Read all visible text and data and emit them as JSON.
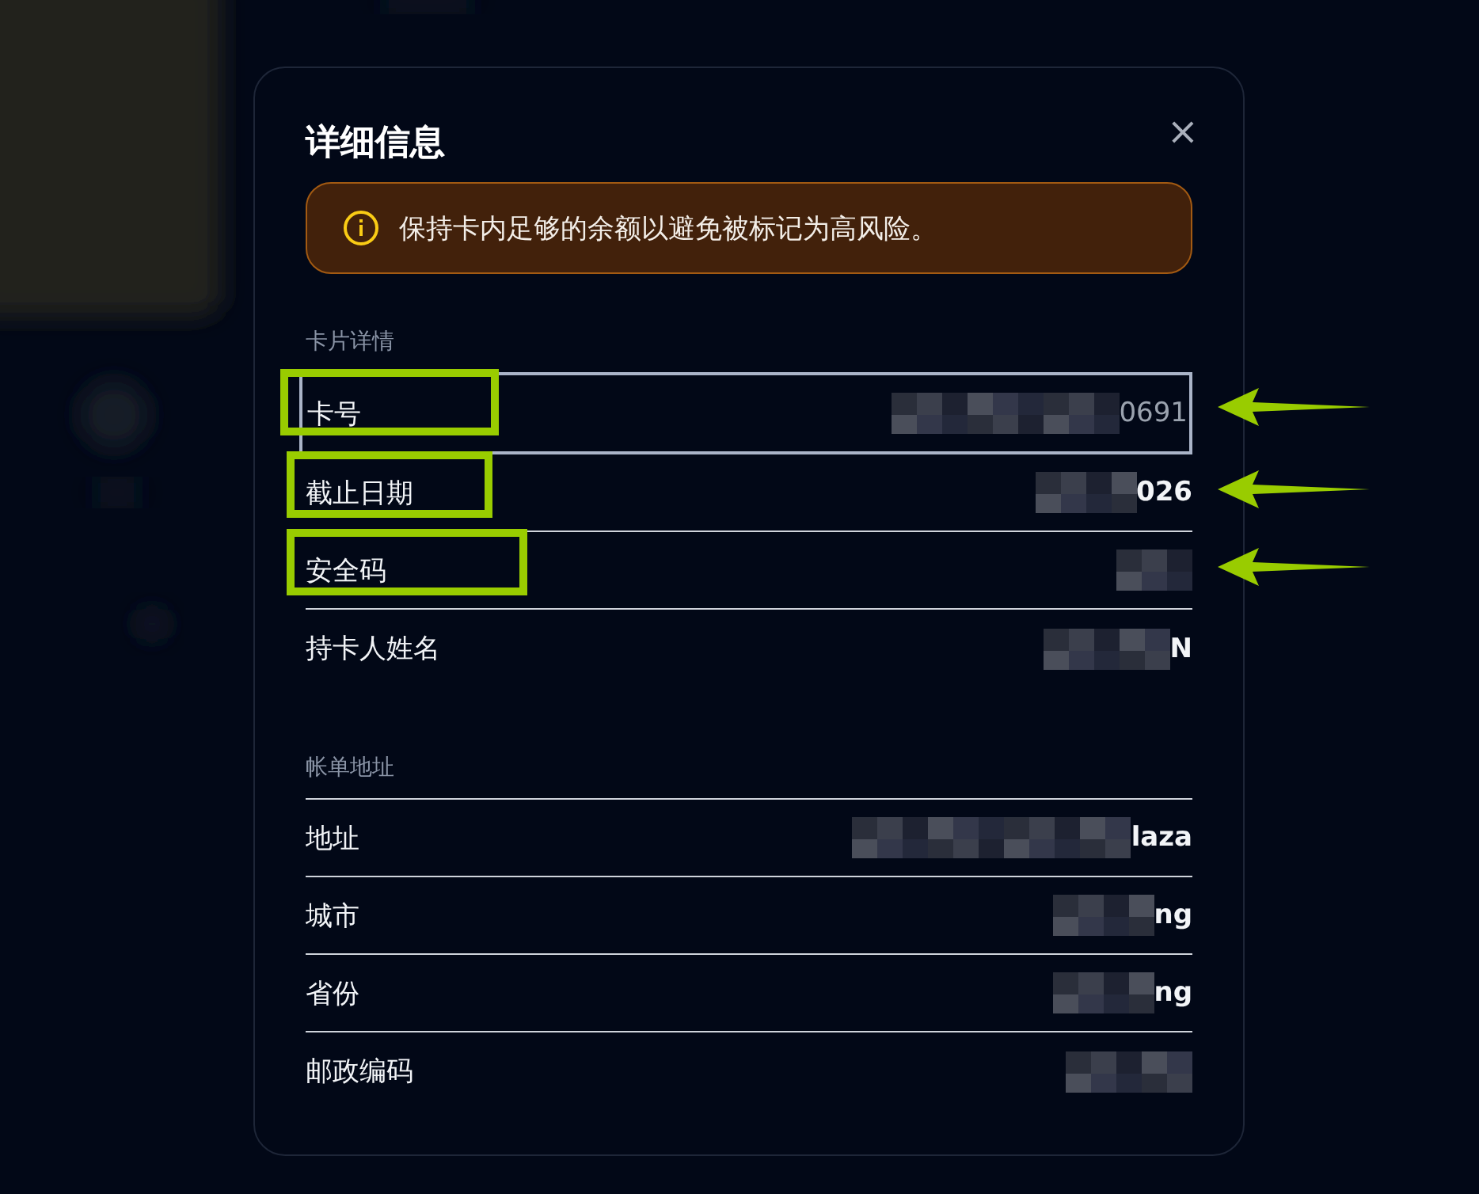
{
  "dialog": {
    "title": "详细信息",
    "close": "×",
    "alert": {
      "text": "保持卡内足够的余额以避免被标记为高风险。"
    },
    "sections": [
      {
        "heading": "卡片详情",
        "rows": [
          {
            "label": "卡号",
            "value": "0691",
            "focused": true,
            "redacted": true,
            "annotated": true
          },
          {
            "label": "截止日期",
            "value": "026",
            "focused": false,
            "redacted": true,
            "annotated": true
          },
          {
            "label": "安全码",
            "focused": false,
            "redacted": true,
            "annotated": true
          },
          {
            "label": "持卡人姓名",
            "value": "N",
            "focused": false,
            "redacted": true,
            "annotated": false
          }
        ]
      },
      {
        "heading": "帐单地址",
        "rows": [
          {
            "label": "地址",
            "value": "laza",
            "focused": false,
            "redacted": true,
            "annotated": false
          },
          {
            "label": "城市",
            "value": "ng",
            "focused": false,
            "redacted": true,
            "annotated": false
          },
          {
            "label": "省份",
            "value": "ng",
            "focused": false,
            "redacted": true,
            "annotated": false
          },
          {
            "label": "邮政编码",
            "focused": false,
            "redacted": true,
            "annotated": false
          }
        ]
      }
    ]
  }
}
